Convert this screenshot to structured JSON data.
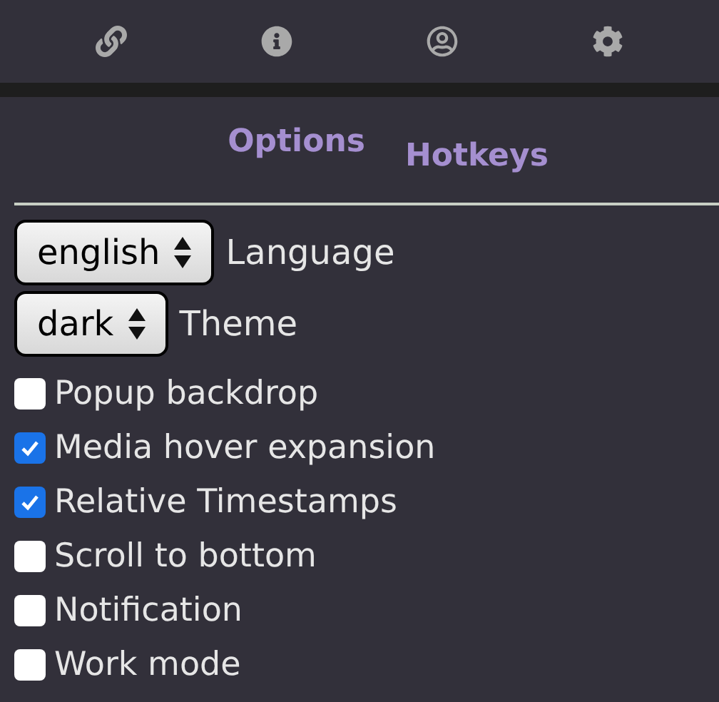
{
  "toolbar": [
    {
      "kind": "link"
    },
    {
      "kind": "info"
    },
    {
      "kind": "user"
    },
    {
      "kind": "settings"
    }
  ],
  "tabs": [
    {
      "label": "Options"
    },
    {
      "label": "Hotkeys"
    }
  ],
  "selects": [
    {
      "value": "english",
      "label": "Language"
    },
    {
      "value": "dark",
      "label": "Theme"
    }
  ],
  "checkboxes": [
    {
      "label": "Popup backdrop",
      "checked": false
    },
    {
      "label": "Media hover expansion",
      "checked": true
    },
    {
      "label": "Relative Timestamps",
      "checked": true
    },
    {
      "label": "Scroll to bottom",
      "checked": false
    },
    {
      "label": "Notification",
      "checked": false
    },
    {
      "label": "Work mode",
      "checked": false
    }
  ]
}
